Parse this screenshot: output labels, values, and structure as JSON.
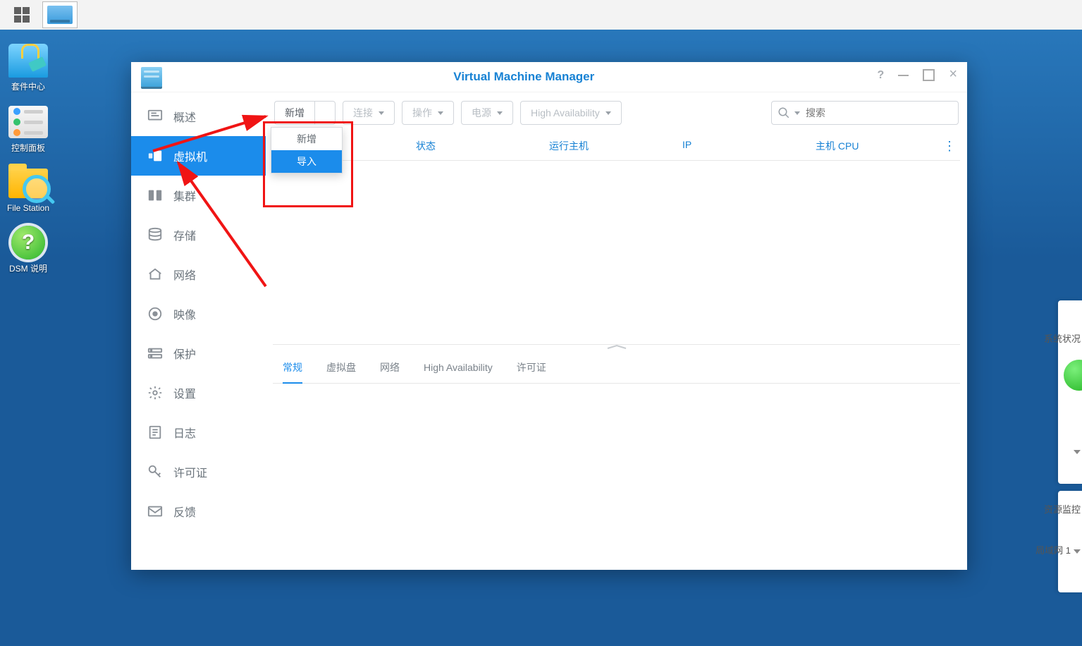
{
  "taskbar": {
    "apps_icon": "apps-grid",
    "nas_icon": "nas"
  },
  "desktop_icons": [
    {
      "id": "pkg",
      "label": "套件中心"
    },
    {
      "id": "ctrl",
      "label": "控制面板"
    },
    {
      "id": "fs",
      "label": "File Station"
    },
    {
      "id": "help",
      "label": "DSM 说明"
    }
  ],
  "right_panel": {
    "status_partial": "系统状况",
    "monitor_partial": "资源监控",
    "lan_partial": "局域网 1"
  },
  "window": {
    "title": "Virtual Machine Manager",
    "help": "?",
    "sidebar": [
      {
        "id": "overview",
        "label": "概述"
      },
      {
        "id": "vm",
        "label": "虚拟机"
      },
      {
        "id": "cluster",
        "label": "集群"
      },
      {
        "id": "storage",
        "label": "存储"
      },
      {
        "id": "network",
        "label": "网络"
      },
      {
        "id": "image",
        "label": "映像"
      },
      {
        "id": "protect",
        "label": "保护"
      },
      {
        "id": "settings",
        "label": "设置"
      },
      {
        "id": "log",
        "label": "日志"
      },
      {
        "id": "license",
        "label": "许可证"
      },
      {
        "id": "feedback",
        "label": "反馈"
      }
    ],
    "toolbar": {
      "add": "新增",
      "connect": "连接",
      "operate": "操作",
      "power": "电源",
      "ha": "High Availability",
      "search_placeholder": "搜索"
    },
    "dropdown": {
      "add": "新增",
      "import": "导入"
    },
    "columns": {
      "status": "状态",
      "hosts": "运行主机",
      "ip": "IP",
      "cpu": "主机 CPU"
    },
    "tabs": {
      "general": "常规",
      "vdisk": "虚拟盘",
      "network": "网络",
      "ha": "High Availability",
      "license": "许可证"
    }
  }
}
